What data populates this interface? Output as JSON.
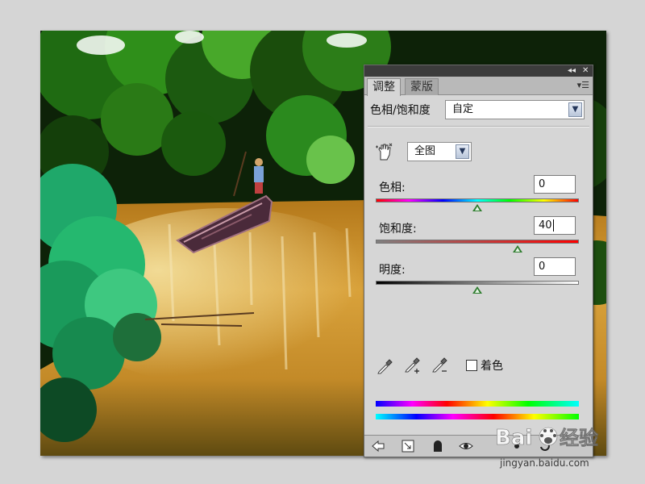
{
  "titlebar": {
    "collapse_glyph": "◂◂",
    "close_glyph": "✕"
  },
  "tabs": [
    {
      "label": "调整",
      "active": true
    },
    {
      "label": "蒙版",
      "active": false
    }
  ],
  "tab_menu_glyph": "▾☰",
  "preset": {
    "label": "色相/饱和度",
    "value": "自定"
  },
  "target_tool": {
    "icon": "hand-target-icon"
  },
  "channel": {
    "value": "全图"
  },
  "hue": {
    "label": "色相:",
    "value": "0",
    "slider_fraction": 0.5
  },
  "saturation": {
    "label": "饱和度:",
    "value": "40",
    "slider_fraction": 0.7
  },
  "lightness": {
    "label": "明度:",
    "value": "0",
    "slider_fraction": 0.5
  },
  "colorize": {
    "label": "着色",
    "checked": false
  },
  "eyedroppers": [
    "eyedropper-icon",
    "eyedropper-plus-icon",
    "eyedropper-minus-icon"
  ],
  "bottom_icons": [
    "back-arrow-icon",
    "expand-view-icon",
    "clip-layer-icon",
    "visibility-eye-icon",
    "previous-state-icon",
    "reset-icon"
  ],
  "watermark": {
    "logo_text": "Baidu经验",
    "url": "jingyan.baidu.com"
  }
}
